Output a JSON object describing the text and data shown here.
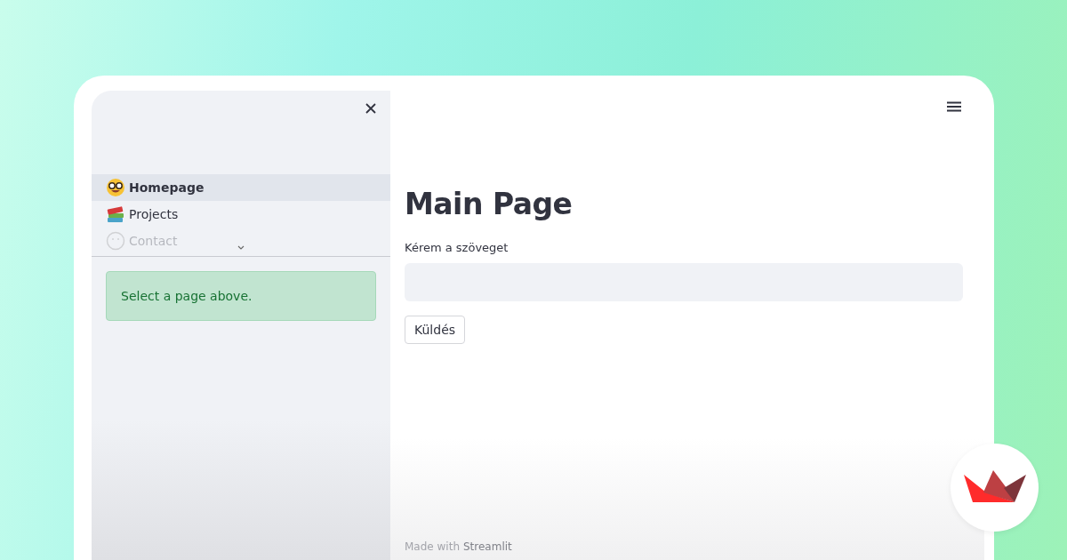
{
  "sidebar": {
    "nav_items": [
      {
        "label": "Homepage",
        "kind": "nerd",
        "selected": true,
        "faded": false
      },
      {
        "label": "Projects",
        "kind": "books",
        "selected": false,
        "faded": false
      },
      {
        "label": "Contact",
        "kind": "face",
        "selected": false,
        "faded": true
      }
    ],
    "alert": {
      "text": "Select a page above."
    }
  },
  "main": {
    "title": "Main Page",
    "field": {
      "label": "Kérem a szöveget"
    },
    "button": "Küldés"
  },
  "footer": {
    "prefix": "Made with",
    "brand": "Streamlit"
  }
}
